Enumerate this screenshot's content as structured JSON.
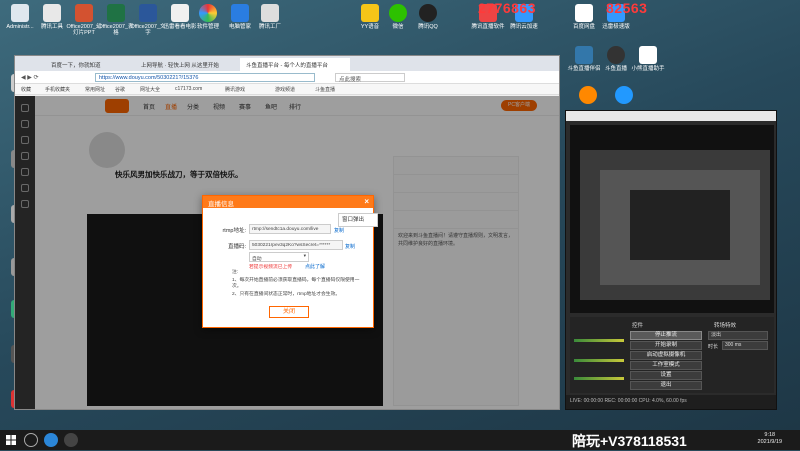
{
  "desktop": {
    "watermark_top_1": "2776863",
    "watermark_top_2": "82563",
    "icons_left": [
      "Administr...",
      "",
      "",
      "",
      "",
      "",
      "",
      ""
    ],
    "icons_top": [
      "腾讯工具",
      "Office2007_幻灯片PPT",
      "Office2007_表格",
      "Office2007_文字",
      "迅雷看看电影",
      "软件管理",
      "电脑管家",
      "腾讯工厂"
    ],
    "icons_top_right": [
      "YY语音",
      "微信",
      "腾讯QQ",
      "",
      "腾讯直播软件",
      "腾讯云加速",
      "百度网盘",
      "迅雷极速版"
    ],
    "icons_right_second": [
      "斗鱼直播伴侣",
      "斗鱼直播",
      "腾讯云加速",
      "小熊直播助手",
      "",
      "",
      "",
      ""
    ]
  },
  "browser": {
    "tabs": [
      "百度一下，你就知道",
      "上网导航 · 轻快上网 从这里开始",
      "斗鱼直播平台 - 每个人的直播平台"
    ],
    "url": "https://www.douyu.com/5030221?/15376",
    "search_placeholder": "点此搜索",
    "bookmarks": [
      "收藏",
      "手机收藏夹",
      "常用网址",
      "谷歌",
      "网址大全",
      "c17173.com",
      "腾讯游戏",
      "游戏频道",
      "斗鱼直播"
    ],
    "site": {
      "nav": [
        "首页",
        "直播",
        "分类",
        "视频",
        "赛事",
        "鱼吧",
        "排行"
      ],
      "pc_button": "PC客户端",
      "room_title": "快乐风男加快乐战刀，等于双倍快乐。",
      "sidebar_text": "欢迎来到斗鱼直播间！请遵守直播规则，文明发言，共同维护良好的直播环境。"
    }
  },
  "modal": {
    "title": "直播信息",
    "close_label": "×",
    "rtmp_label": "rtmp地址:",
    "rtmp_value": "rtmp://sendtc1a.douyu.com/live",
    "code_label": "直播码:",
    "code_value": "5030221rpev3q2Ko?wsSecret=******",
    "copy_label": "复制",
    "dropdown_value": "自动",
    "warn_text": "若提示视频流已上传",
    "learn_link": "点此了解",
    "notes_title": "注:",
    "notes": [
      "1、每次开始直播前必须获取直播码，每个直播码仅限使用一次。",
      "2、只有在直播间状态正常时，rtmp地址才会生效。"
    ],
    "close_button": "关闭",
    "float_popup": "窗口弹出"
  },
  "obs": {
    "controls_title": "控件",
    "mode_title": "转场特效",
    "buttons": [
      "停止推流",
      "开始录制",
      "启动虚拟摄像机",
      "工作室模式",
      "设置",
      "退出"
    ],
    "transition_value": "淡出",
    "duration_label": "时长",
    "duration_value": "300 ms",
    "status": "LIVE: 00:00:00   REC: 00:00:00   CPU: 4.0%, 60.00 fps"
  },
  "taskbar": {
    "time": "9:18",
    "date": "2021/9/19",
    "watermark": "陪玩+V378118531"
  }
}
